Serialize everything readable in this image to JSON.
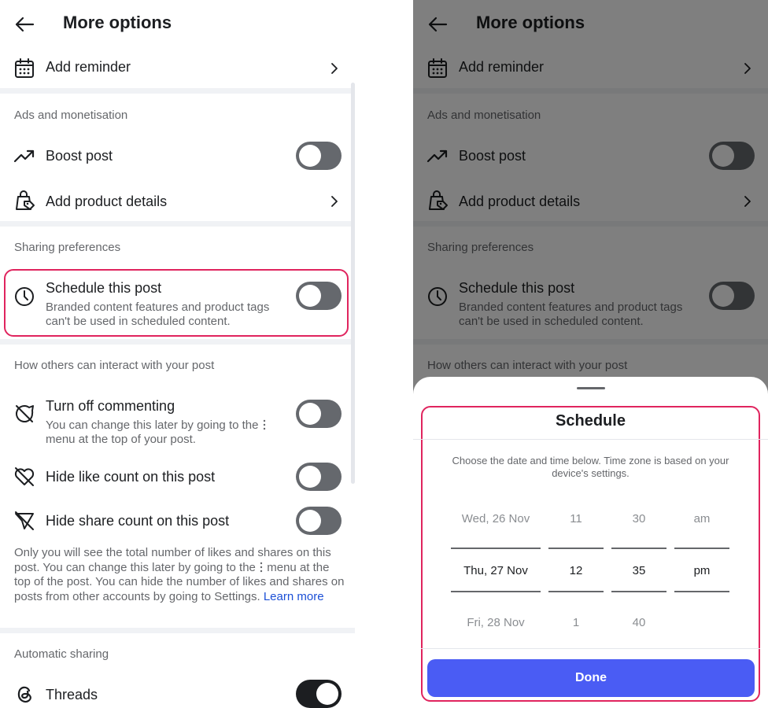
{
  "header": {
    "title": "More options"
  },
  "rows": {
    "add_reminder": "Add reminder",
    "boost_post": "Boost post",
    "add_product_details": "Add product details",
    "schedule_post": "Schedule this post",
    "schedule_post_sub": "Branded content features and product tags can't be used in scheduled content.",
    "turn_off_commenting": "Turn off commenting",
    "turn_off_commenting_sub": "You can change this later by going to the",
    "turn_off_commenting_sub2": "menu at the top of your post.",
    "hide_like_count": "Hide like count on this post",
    "hide_share_count": "Hide share count on this post",
    "threads": "Threads"
  },
  "sections": {
    "ads": "Ads and monetisation",
    "sharing": "Sharing preferences",
    "interact": "How others can interact with your post",
    "automatic": "Automatic sharing"
  },
  "info_paragraph": {
    "part1": "Only you will see the total number of likes and shares on this post. You can change this later by going to the",
    "part2": "menu at the top of the post. You can hide the number of likes and shares on posts from other accounts by going to Settings.",
    "link": "Learn more"
  },
  "toggles": {
    "boost_post": false,
    "schedule_post": false,
    "turn_off_commenting": false,
    "hide_like_count": false,
    "hide_share_count": false,
    "threads": true
  },
  "schedule_sheet": {
    "title": "Schedule",
    "description": "Choose the date and time below. Time zone is based on your device's settings.",
    "picker": {
      "date": [
        "Wed, 26 Nov",
        "Thu, 27 Nov",
        "Fri, 28 Nov"
      ],
      "hour": [
        "11",
        "12",
        "1"
      ],
      "minute": [
        "30",
        "35",
        "40"
      ],
      "period": [
        "am",
        "pm",
        ""
      ]
    },
    "done_label": "Done"
  },
  "colors": {
    "highlight": "#e0245e",
    "done_button": "#4a5cf4",
    "link": "#1b4fd6",
    "toggle_off": "#65686d",
    "toggle_on": "#1c1e21"
  }
}
